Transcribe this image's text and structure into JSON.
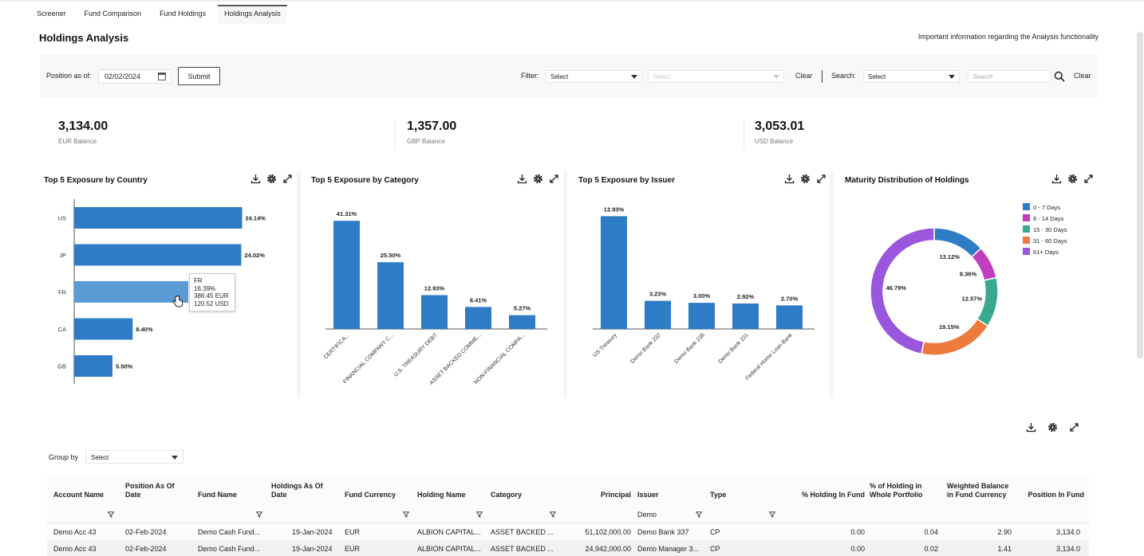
{
  "tabs": [
    {
      "label": "Screener",
      "active": false
    },
    {
      "label": "Fund Comparison",
      "active": false
    },
    {
      "label": "Fund Holdings",
      "active": false
    },
    {
      "label": "Holdings Analysis",
      "active": true
    }
  ],
  "page": {
    "title": "Holdings Analysis",
    "info_link": "Important information regarding the Analysis functionality"
  },
  "filterbar": {
    "position_label": "Position as of:",
    "position_date": "02/02/2024",
    "submit_label": "Submit",
    "filter_label": "Filter:",
    "filter_select_1": "Select",
    "filter_select_2": "Select",
    "clear_label": "Clear",
    "search_label": "Search:",
    "search_select": "Select",
    "search_placeholder": "Search",
    "clear2_label": "Clear"
  },
  "balances": [
    {
      "value": "3,134.00",
      "label": "EUR Balance"
    },
    {
      "value": "1,357.00",
      "label": "GBP Balance"
    },
    {
      "value": "3,053.01",
      "label": "USD Balance"
    }
  ],
  "colors": {
    "bar": "#2f7cc6",
    "bar_hover": "#5a9bd6",
    "maturity": [
      "#2f7cc6",
      "#c13cbf",
      "#3aa88f",
      "#ee7a3d",
      "#9a57dd"
    ]
  },
  "charts": {
    "country_title": "Top 5 Exposure by Country",
    "category_title": "Top 5 Exposure by Category",
    "issuer_title": "Top 5 Exposure by Issuer",
    "maturity_title": "Maturity Distribution of Holdings",
    "tooltip": [
      "FR",
      "16.39%",
      "386.45 EUR",
      "120.52 USD"
    ]
  },
  "chart_data": [
    {
      "type": "bar",
      "orientation": "horizontal",
      "title": "Top 5 Exposure by Country",
      "categories": [
        "US",
        "JP",
        "FR",
        "CA",
        "GB"
      ],
      "values": [
        24.14,
        24.02,
        16.39,
        8.4,
        5.5
      ],
      "labels": [
        "24.14%",
        "24.02%",
        "16.39%",
        "8.40%",
        "5.50%"
      ]
    },
    {
      "type": "bar",
      "title": "Top 5 Exposure by Category",
      "categories": [
        "CERTIFICA...",
        "FINANCIAL COMPANY C...",
        "U.S. TREASURY DEBT",
        "ASSET BACKED COMME...",
        "NON-FINANCIAL COMPA..."
      ],
      "values": [
        41.31,
        25.5,
        12.93,
        8.41,
        5.27
      ],
      "labels": [
        "41.31%",
        "25.50%",
        "12.93%",
        "8.41%",
        "5.27%"
      ]
    },
    {
      "type": "bar",
      "title": "Top 5 Exposure by Issuer",
      "categories": [
        "US Treasury",
        "Demo Bank 232",
        "Demo Bank 238",
        "Demo Bank 231",
        "Federal Home Loan Bank"
      ],
      "values": [
        12.93,
        3.23,
        3.0,
        2.92,
        2.7
      ],
      "labels": [
        "12.93%",
        "3.23%",
        "3.00%",
        "2.92%",
        "2.70%"
      ]
    },
    {
      "type": "pie",
      "title": "Maturity Distribution of Holdings",
      "categories": [
        "0 - 7 Days",
        "8 - 14 Days",
        "15 - 30 Days",
        "31 - 60 Days",
        "61+ Days"
      ],
      "values": [
        13.12,
        8.36,
        12.57,
        19.15,
        46.79
      ],
      "labels": [
        "13.12%",
        "8.36%",
        "12.57%",
        "19.15%",
        "46.79%"
      ],
      "legend": "top-right"
    }
  ],
  "table": {
    "groupby_label": "Group by",
    "groupby_value": "Select",
    "issuer_filter_value": "Demo",
    "headers": [
      [
        "Account Name"
      ],
      [
        "Position As Of",
        "Date"
      ],
      [
        "Fund Name"
      ],
      [
        "Holdings As Of",
        "Date"
      ],
      [
        "Fund Currency"
      ],
      [
        "Holding Name"
      ],
      [
        "Category"
      ],
      [
        "Principal"
      ],
      [
        "Issuer"
      ],
      [
        "Type"
      ],
      [
        "% Holding In Fund"
      ],
      [
        "% of Holding in",
        "Whole Portfolio"
      ],
      [
        "Weighted Balance",
        "in Fund Currency"
      ],
      [
        "Position In Fund"
      ]
    ],
    "rows": [
      [
        "Demo Acc 43",
        "02-Feb-2024",
        "Demo Cash Fund...",
        "19-Jan-2024",
        "EUR",
        "ALBION CAPITAL...",
        "ASSET BACKED ...",
        "51,102,000.00",
        "Demo Bank 337",
        "CP",
        "0.00",
        "0.04",
        "2.90",
        "3,134.0"
      ],
      [
        "Demo Acc 43",
        "02-Feb-2024",
        "Demo Cash Fund...",
        "19-Jan-2024",
        "EUR",
        "ALBION CAPITAL...",
        "ASSET BACKED ...",
        "24,942,000.00",
        "Demo Manager 3...",
        "CP",
        "0.00",
        "0.02",
        "1.41",
        "3,134.0"
      ]
    ]
  }
}
